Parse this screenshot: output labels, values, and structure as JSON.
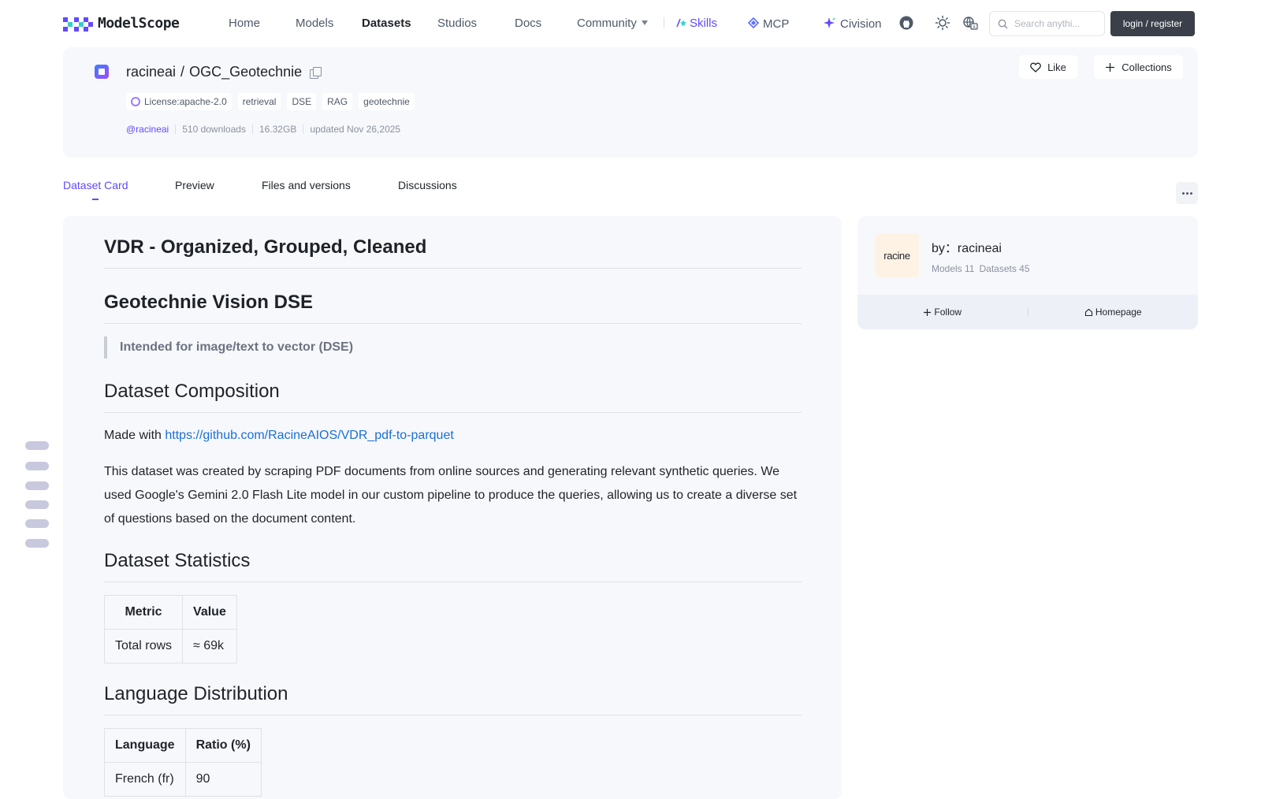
{
  "nav": {
    "logo_text": "ModelScope",
    "items": [
      {
        "label": "Home"
      },
      {
        "label": "Models"
      },
      {
        "label": "Datasets"
      },
      {
        "label": "Studios"
      },
      {
        "label": "Docs"
      },
      {
        "label": "Community"
      },
      {
        "label": "Skills"
      },
      {
        "label": "MCP"
      },
      {
        "label": "Civision"
      }
    ],
    "search_placeholder": "Search anythi...",
    "login_label": "login / register",
    "icons": [
      "github-icon",
      "theme-sun-icon",
      "language-icon",
      "search-icon"
    ]
  },
  "repo": {
    "owner": "racineai",
    "separator": "/",
    "name": "OGC_Geotechnie",
    "tags": [
      "License:apache-2.0",
      "retrieval",
      "DSE",
      "RAG",
      "geotechnie"
    ],
    "author_handle": "@racineai",
    "downloads": "510 downloads",
    "size": "16.32GB",
    "updated": "updated Nov 26,2025",
    "like_label": "Like",
    "collections_label": "Collections"
  },
  "tabs": [
    {
      "label": "Dataset Card",
      "active": true
    },
    {
      "label": "Preview"
    },
    {
      "label": "Files and versions"
    },
    {
      "label": "Discussions"
    }
  ],
  "card": {
    "h1": "VDR - Organized, Grouped, Cleaned",
    "h2_vision": "Geotechnie Vision DSE",
    "blockquote": "Intended for image/text to vector (DSE)",
    "h2_composition": "Dataset Composition",
    "made_with_prefix": "Made with",
    "made_with_link": "https://github.com/RacineAIOS/VDR_pdf-to-parquet",
    "description": "This dataset was created by scraping PDF documents from online sources and generating relevant synthetic queries. We used Google's Gemini 2.0 Flash Lite model in our custom pipeline to produce the queries, allowing us to create a diverse set of questions based on the document content.",
    "h2_statistics": "Dataset Statistics",
    "stats_table": {
      "headers": [
        "Metric",
        "Value"
      ],
      "rows": [
        [
          "Total rows",
          "≈ 69k"
        ]
      ]
    },
    "h2_language": "Language Distribution",
    "lang_table": {
      "headers": [
        "Language",
        "Ratio (%)"
      ],
      "rows": [
        [
          "French (fr)",
          "90"
        ]
      ]
    }
  },
  "author_card": {
    "logo_text": "racine",
    "name": "by：racineai",
    "models": "Models 11",
    "datasets": "Datasets 45",
    "follow_label": "Follow",
    "homepage_label": "Homepage"
  },
  "colors": {
    "accent": "#624aff",
    "link": "#1a6fd6",
    "card_bg": "#f7f8fc",
    "login_bg": "#3a3f4a"
  }
}
